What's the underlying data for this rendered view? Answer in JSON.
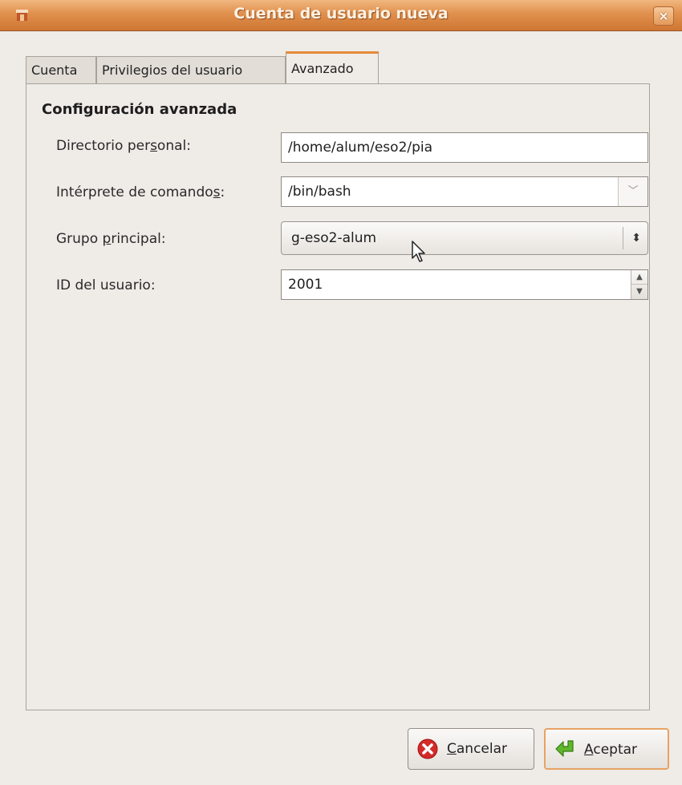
{
  "window": {
    "title": "Cuenta de usuario nueva",
    "close_glyph": "×"
  },
  "tabs": [
    {
      "label": "Cuenta",
      "active": false
    },
    {
      "label": "Privilegios del usuario",
      "active": false
    },
    {
      "label": "Avanzado",
      "active": true
    }
  ],
  "section": {
    "title": "Configuración avanzada"
  },
  "fields": {
    "home_dir": {
      "label_pre": "Directorio per",
      "mnemonic": "s",
      "label_post": "onal:",
      "value": "/home/alum/eso2/pia"
    },
    "shell": {
      "label_pre": "Intérprete de comando",
      "mnemonic": "s",
      "label_post": ":",
      "value": "/bin/bash"
    },
    "group": {
      "label_pre": "Grupo ",
      "mnemonic": "p",
      "label_post": "rincipal:",
      "value": "g-eso2-alum"
    },
    "user_id": {
      "label": "ID del usuario:",
      "value": "2001"
    }
  },
  "buttons": {
    "cancel": {
      "mnemonic": "C",
      "rest": "ancelar"
    },
    "accept": {
      "mnemonic": "A",
      "rest": "ceptar"
    }
  },
  "icons": {
    "app": "app-icon",
    "close": "close-icon",
    "cancel": "cancel-icon",
    "accept": "accept-icon",
    "cursor": "mouse-cursor-icon"
  },
  "colors": {
    "titlebar": "#e0904d",
    "active_tab_accent": "#e48a39",
    "window_bg": "#efebe7"
  }
}
